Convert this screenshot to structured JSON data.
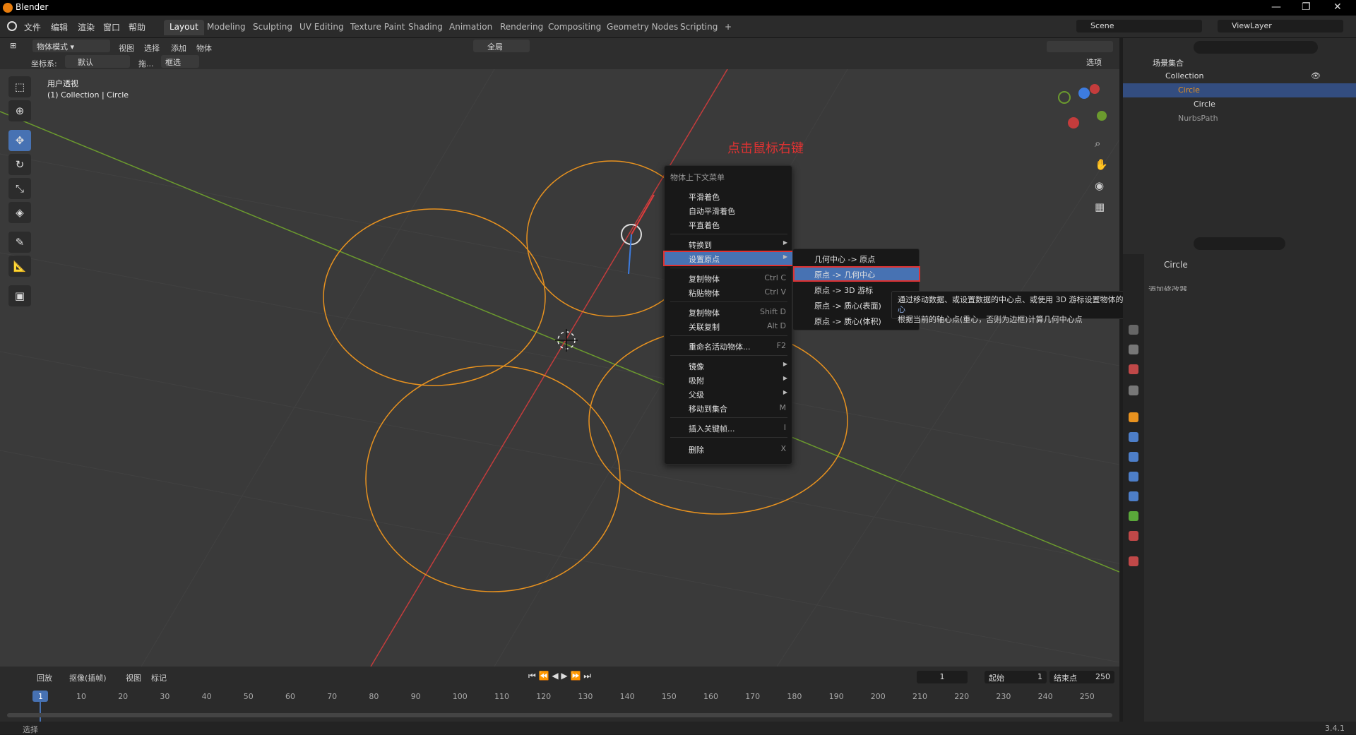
{
  "app": {
    "title": "Blender",
    "version": "3.4.1"
  },
  "window_controls": {
    "minimize": "—",
    "maximize": "❐",
    "close": "✕"
  },
  "menu": [
    "文件",
    "编辑",
    "渲染",
    "窗口",
    "帮助"
  ],
  "workspaces": [
    "Layout",
    "Modeling",
    "Sculpting",
    "UV Editing",
    "Texture Paint",
    "Shading",
    "Animation",
    "Rendering",
    "Compositing",
    "Geometry Nodes",
    "Scripting",
    "+"
  ],
  "scene": {
    "name": "Scene",
    "viewlayer": "ViewLayer"
  },
  "viewport_header": {
    "mode": "物体模式",
    "menus": [
      "视图",
      "选择",
      "添加",
      "物体"
    ],
    "transform": "全局",
    "coord_label": "坐标系:",
    "coord_value": "默认",
    "drag_label": "拖...",
    "drag_value": "框选",
    "options": "选项"
  },
  "viewport": {
    "view_name": "用户透视",
    "collection_info": "(1) Collection | Circle",
    "annotation": "点击鼠标右键"
  },
  "tools": [
    "select-box",
    "cursor",
    "move",
    "rotate",
    "scale",
    "transform",
    "annotate",
    "measure",
    "add-cube"
  ],
  "context_menu": {
    "title": "物体上下文菜单",
    "items": [
      {
        "label": "平滑着色",
        "shortcut": ""
      },
      {
        "label": "自动平滑着色",
        "shortcut": ""
      },
      {
        "label": "平直着色",
        "shortcut": ""
      },
      {
        "label": "转换到",
        "shortcut": ""
      },
      {
        "label": "设置原点",
        "shortcut": ""
      },
      {
        "label": "复制物体",
        "shortcut": "Ctrl C"
      },
      {
        "label": "粘贴物体",
        "shortcut": "Ctrl V"
      },
      {
        "label": "复制物体",
        "shortcut": "Shift D"
      },
      {
        "label": "关联复制",
        "shortcut": "Alt D"
      },
      {
        "label": "重命名活动物体...",
        "shortcut": "F2"
      },
      {
        "label": "镜像",
        "shortcut": ""
      },
      {
        "label": "吸附",
        "shortcut": ""
      },
      {
        "label": "父级",
        "shortcut": ""
      },
      {
        "label": "移动到集合",
        "shortcut": "M"
      },
      {
        "label": "插入关键帧...",
        "shortcut": "I"
      },
      {
        "label": "删除",
        "shortcut": "X"
      }
    ]
  },
  "submenu": {
    "items": [
      "几何中心 -> 原点",
      "原点 -> 几何中心",
      "原点 -> 3D 游标",
      "原点 -> 质心(表面)",
      "原点 -> 质心(体积)"
    ]
  },
  "tooltip": {
    "line1": "通过移动数据、或设置数据的中心点、或使用 3D 游标设置物体的原点:",
    "line1_link": "原点 -> 几何中心",
    "line2": "根据当前的轴心点(重心，否则为边框)计算几何中心点"
  },
  "outliner": {
    "root": "场景集合",
    "items": [
      {
        "name": "Collection",
        "level": 0
      },
      {
        "name": "Circle",
        "level": 1
      },
      {
        "name": "Circle",
        "level": 2
      },
      {
        "name": "NurbsPath",
        "level": 1
      }
    ]
  },
  "properties": {
    "object_name": "Circle",
    "truncated_field": "添加修改器"
  },
  "timeline": {
    "playback": "回放",
    "keying": "抠像(插帧)",
    "view": "视图",
    "marker": "标记",
    "current_frame": "1",
    "start_label": "起始",
    "start_value": "1",
    "end_label": "结束点",
    "end_value": "250",
    "ticks": [
      "1",
      "10",
      "20",
      "30",
      "40",
      "50",
      "60",
      "70",
      "80",
      "90",
      "100",
      "110",
      "120",
      "130",
      "140",
      "150",
      "160",
      "170",
      "180",
      "190",
      "200",
      "210",
      "220",
      "230",
      "240",
      "250"
    ]
  },
  "statusbar": {
    "select": "选择"
  },
  "colors": {
    "accent": "#4772b3",
    "highlight_border": "#e03232",
    "selection_orange": "#e8921f",
    "x_axis": "#c43c3c",
    "y_axis": "#6b9a2e"
  }
}
